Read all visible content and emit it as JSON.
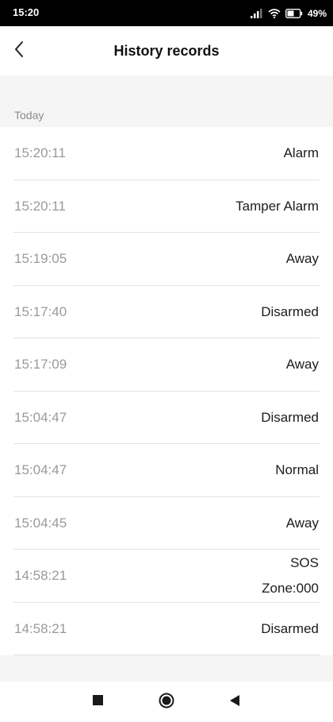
{
  "status_bar": {
    "time": "15:20",
    "battery_percent": "49%",
    "icons": [
      "signal-icon",
      "wifi-icon",
      "battery-icon"
    ]
  },
  "header": {
    "title": "History records",
    "back_icon": "chevron-left-icon"
  },
  "section": {
    "label": "Today"
  },
  "records": [
    {
      "time": "15:20:11",
      "event": "Alarm",
      "detail": ""
    },
    {
      "time": "15:20:11",
      "event": "Tamper Alarm",
      "detail": ""
    },
    {
      "time": "15:19:05",
      "event": "Away",
      "detail": ""
    },
    {
      "time": "15:17:40",
      "event": "Disarmed",
      "detail": ""
    },
    {
      "time": "15:17:09",
      "event": "Away",
      "detail": ""
    },
    {
      "time": "15:04:47",
      "event": "Disarmed",
      "detail": ""
    },
    {
      "time": "15:04:47",
      "event": "Normal",
      "detail": ""
    },
    {
      "time": "15:04:45",
      "event": "Away",
      "detail": ""
    },
    {
      "time": "14:58:21",
      "event": "SOS",
      "detail": "Zone:000"
    },
    {
      "time": "14:58:21",
      "event": "Disarmed",
      "detail": ""
    }
  ],
  "navigation": {
    "icons": [
      "recent-apps-icon",
      "home-icon",
      "back-icon"
    ]
  },
  "colors": {
    "status_bar_bg": "#000000",
    "page_bg": "#f5f5f5",
    "card_bg": "#ffffff",
    "time_text": "#9a9a9a",
    "event_text": "#1c1c1c",
    "divider": "#e2e2e2"
  }
}
